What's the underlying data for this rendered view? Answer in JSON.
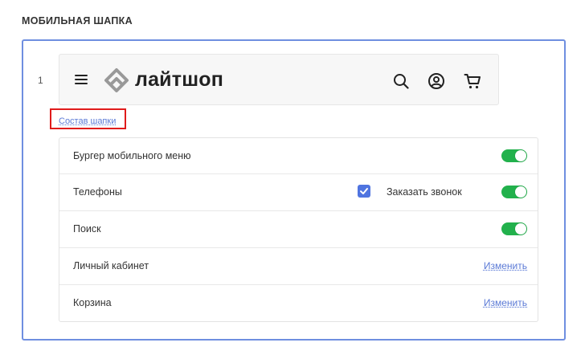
{
  "section": {
    "title": "МОБИЛЬНАЯ ШАПКА"
  },
  "header_option": {
    "number": "1",
    "logo_text": "лайтшоп",
    "icons": [
      "burger-menu-icon",
      "search-icon",
      "user-icon",
      "cart-icon"
    ],
    "compose_link": "Состав шапки"
  },
  "items": [
    {
      "label": "Бургер мобильного меню",
      "control": "toggle",
      "enabled": true
    },
    {
      "label": "Телефоны",
      "control": "toggle",
      "enabled": true,
      "checkbox": {
        "label": "Заказать звонок",
        "checked": true
      }
    },
    {
      "label": "Поиск",
      "control": "toggle",
      "enabled": true
    },
    {
      "label": "Личный кабинет",
      "control": "link",
      "link_label": "Изменить"
    },
    {
      "label": "Корзина",
      "control": "link",
      "link_label": "Изменить"
    }
  ],
  "colors": {
    "accent": "#6f8fe0",
    "link": "#5b7ad6",
    "toggle_on": "#22b14c",
    "highlight": "#e01b1b",
    "checkbox": "#4f74e0"
  }
}
